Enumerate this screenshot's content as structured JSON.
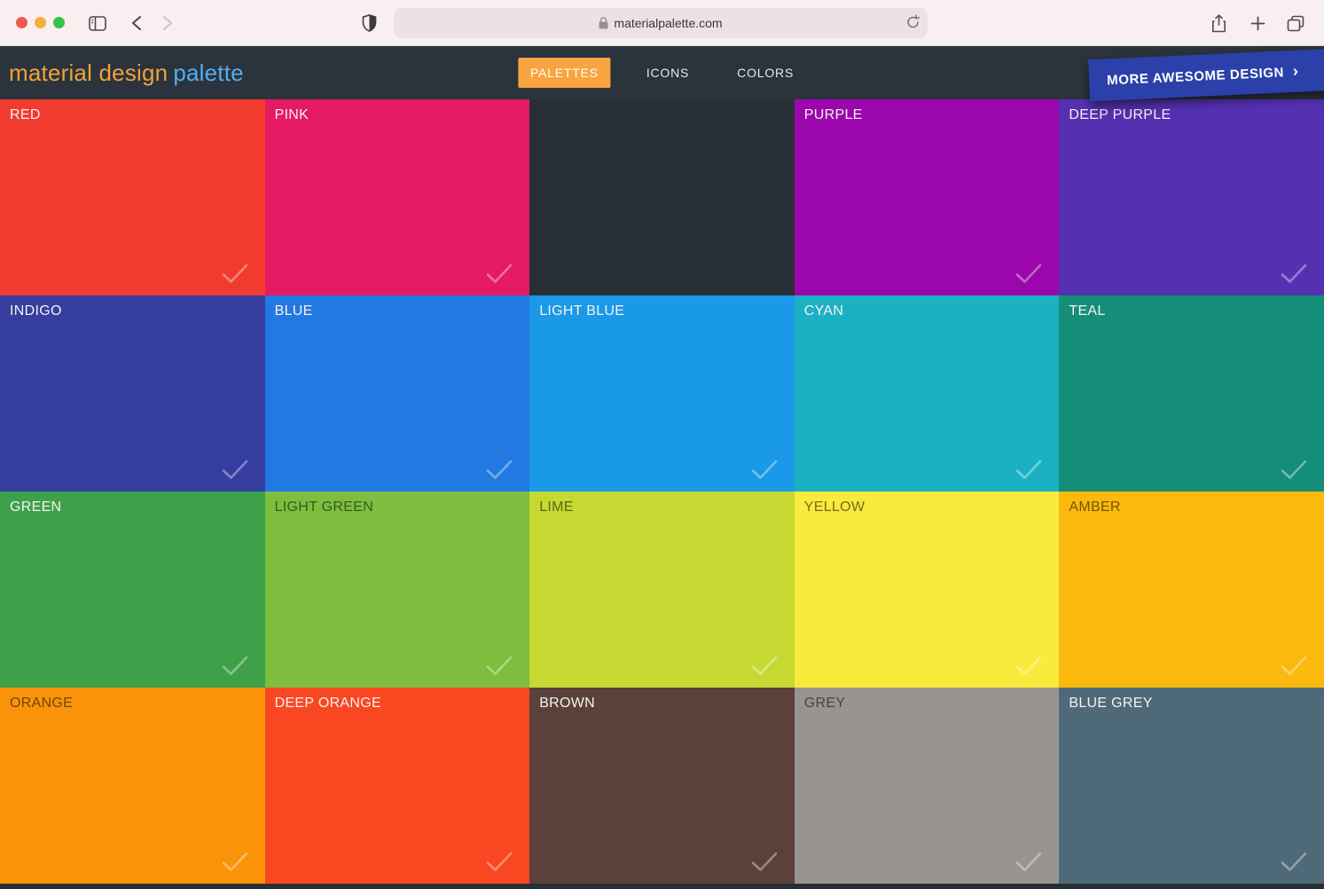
{
  "browser": {
    "url": "materialpalette.com",
    "traffic_lights": {
      "red": "#F0594F",
      "yellow": "#F0B03C",
      "green": "#33C441"
    },
    "icon_color": "#4F4A4C"
  },
  "header": {
    "background": "#2B333C",
    "logo": {
      "part1": "material design",
      "part2": "palette",
      "part1_color": "#EFA33B",
      "part2_color": "#54ACEE"
    },
    "nav": [
      {
        "label": "PALETTES",
        "active": true
      },
      {
        "label": "ICONS",
        "active": false
      },
      {
        "label": "COLORS",
        "active": false
      }
    ],
    "active_tab_color": "#F9A440",
    "ribbon": {
      "label": "MORE AWESOME DESIGN",
      "chevron": "›",
      "color": "#2B41A9"
    }
  },
  "palette": {
    "background": "#272E36",
    "tiles": [
      {
        "label": "RED",
        "color": "#F23B2F",
        "text": "light",
        "check": true
      },
      {
        "label": "PINK",
        "color": "#E41A62",
        "text": "light",
        "check": true
      },
      {
        "label": "",
        "color": "",
        "text": "light",
        "check": false,
        "empty": true
      },
      {
        "label": "PURPLE",
        "color": "#9B07AC",
        "text": "light",
        "check": true
      },
      {
        "label": "DEEP PURPLE",
        "color": "#5531B2",
        "text": "light",
        "check": true
      },
      {
        "label": "INDIGO",
        "color": "#353E9E",
        "text": "light",
        "check": true
      },
      {
        "label": "BLUE",
        "color": "#2379E2",
        "text": "light",
        "check": true
      },
      {
        "label": "LIGHT BLUE",
        "color": "#1999E8",
        "text": "light",
        "check": true
      },
      {
        "label": "CYAN",
        "color": "#1CB0C4",
        "text": "light",
        "check": true
      },
      {
        "label": "TEAL",
        "color": "#148E78",
        "text": "light",
        "check": true
      },
      {
        "label": "GREEN",
        "color": "#3FA04A",
        "text": "light",
        "check": true
      },
      {
        "label": "LIGHT GREEN",
        "color": "#7DBE3E",
        "text": "dark",
        "check": true
      },
      {
        "label": "LIME",
        "color": "#C5D932",
        "text": "dark",
        "check": true
      },
      {
        "label": "YELLOW",
        "color": "#F9EA3C",
        "text": "dark",
        "check": true
      },
      {
        "label": "AMBER",
        "color": "#FBB90D",
        "text": "dark",
        "check": true
      },
      {
        "label": "ORANGE",
        "color": "#FA930A",
        "text": "dark",
        "check": true
      },
      {
        "label": "DEEP ORANGE",
        "color": "#F94721",
        "text": "light",
        "check": true
      },
      {
        "label": "BROWN",
        "color": "#5A423A",
        "text": "light",
        "check": true
      },
      {
        "label": "GREY",
        "color": "#979492",
        "text": "dark",
        "check": true
      },
      {
        "label": "BLUE GREY",
        "color": "#4E6A78",
        "text": "light",
        "check": true
      }
    ]
  }
}
